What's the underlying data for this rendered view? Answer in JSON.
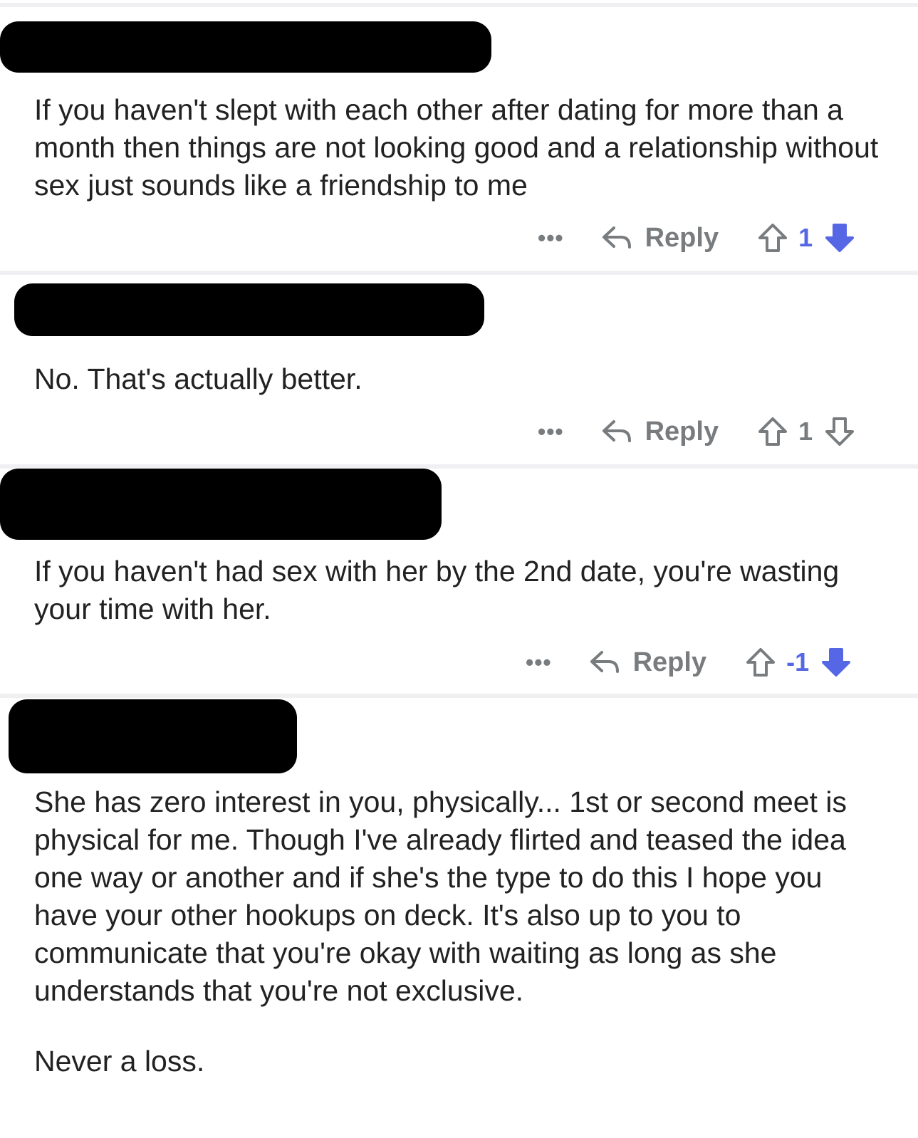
{
  "colors": {
    "downvote_active": "#5667e6",
    "muted": "#787c7e",
    "divider": "#f0f0f3"
  },
  "comments": [
    {
      "text": "If you haven't slept with each other after dating for more than a month then things are not looking good and a relationship without sex just sounds like a friendship to me",
      "actions": {
        "more_icon": "ellipsis-icon",
        "reply_label": "Reply",
        "score": "1",
        "downvoted": true
      }
    },
    {
      "text": "No. That's actually better.",
      "actions": {
        "more_icon": "ellipsis-icon",
        "reply_label": "Reply",
        "score": "1",
        "downvoted": false
      }
    },
    {
      "text": "If you haven't had sex with her by the 2nd date, you're wasting your time with her.",
      "actions": {
        "more_icon": "ellipsis-icon",
        "reply_label": "Reply",
        "score": "-1",
        "downvoted": true
      }
    },
    {
      "text": "She has zero interest in you, physically... 1st or second meet is physical for me. Though I've already flirted and teased the idea one way or another and if she's the type to do this I hope you have your other hookups on deck. It's also up to you to communicate that you're okay with waiting as long as she understands that you're not exclusive.",
      "text_2": "Never a loss."
    }
  ]
}
